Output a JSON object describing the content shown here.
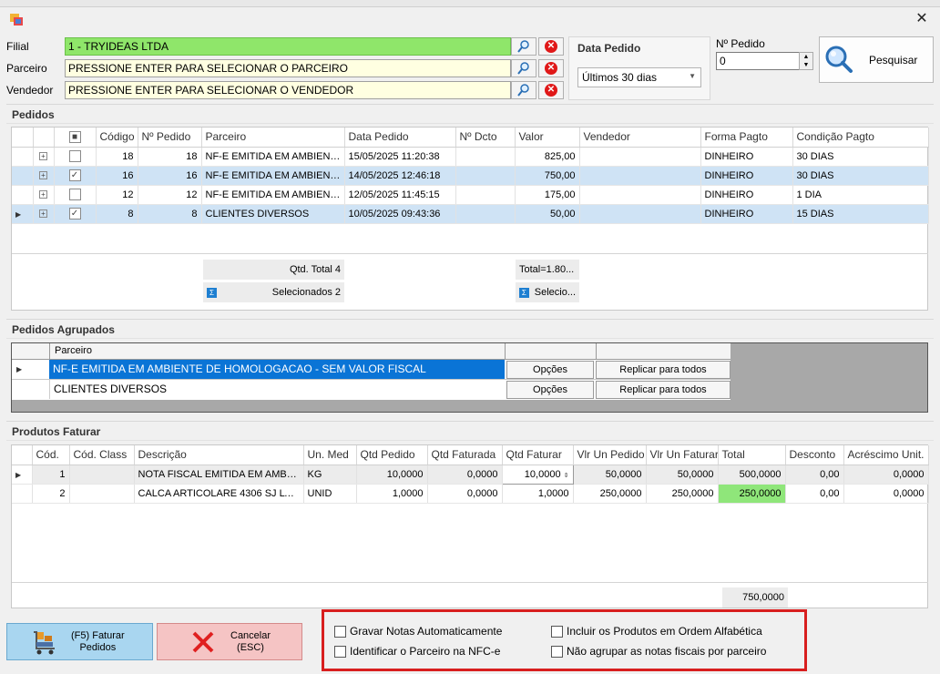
{
  "filters": {
    "filial_label": "Filial",
    "filial_value": "1 - TRYIDEAS LTDA",
    "parceiro_label": "Parceiro",
    "parceiro_value": "PRESSIONE ENTER PARA SELECIONAR O PARCEIRO",
    "vendedor_label": "Vendedor",
    "vendedor_value": "PRESSIONE ENTER PARA SELECIONAR O VENDEDOR",
    "data_pedido_label": "Data Pedido",
    "data_pedido_value": "Últimos 30 dias",
    "n_pedido_label": "Nº Pedido",
    "n_pedido_value": "0",
    "search_label": "Pesquisar"
  },
  "pedidos": {
    "title": "Pedidos",
    "columns": [
      "Código",
      "Nº Pedido",
      "Parceiro",
      "Data Pedido",
      "Nº Dcto",
      "Valor",
      "Vendedor",
      "Forma Pagto",
      "Condição Pagto"
    ],
    "rows": [
      {
        "checked": false,
        "codigo": "18",
        "n_pedido": "18",
        "parceiro": "NF-E EMITIDA EM AMBIENT...",
        "data": "15/05/2025 11:20:38",
        "dcto": "",
        "valor": "825,00",
        "vendedor": "",
        "forma": "DINHEIRO",
        "condicao": "30 DIAS",
        "selected": false
      },
      {
        "checked": true,
        "codigo": "16",
        "n_pedido": "16",
        "parceiro": "NF-E EMITIDA EM AMBIENT...",
        "data": "14/05/2025 12:46:18",
        "dcto": "",
        "valor": "750,00",
        "vendedor": "",
        "forma": "DINHEIRO",
        "condicao": "30 DIAS",
        "selected": true
      },
      {
        "checked": false,
        "codigo": "12",
        "n_pedido": "12",
        "parceiro": "NF-E EMITIDA EM AMBIENT...",
        "data": "12/05/2025 11:45:15",
        "dcto": "",
        "valor": "175,00",
        "vendedor": "",
        "forma": "DINHEIRO",
        "condicao": "1 DIA",
        "selected": false
      },
      {
        "checked": true,
        "codigo": "8",
        "n_pedido": "8",
        "parceiro": "CLIENTES DIVERSOS",
        "data": "10/05/2025 09:43:36",
        "dcto": "",
        "valor": "50,00",
        "vendedor": "",
        "forma": "DINHEIRO",
        "condicao": "15 DIAS",
        "selected": true
      }
    ],
    "qtd_total": "Qtd. Total 4",
    "selecionados": "Selecionados 2",
    "total_valor": "Total=1.80...",
    "selecio_valor": "Selecio..."
  },
  "agrupados": {
    "title": "Pedidos Agrupados",
    "column": "Parceiro",
    "rows": [
      {
        "parceiro": "NF-E EMITIDA EM AMBIENTE DE HOMOLOGACAO - SEM VALOR FISCAL",
        "opcoes": "Opções",
        "replicar": "Replicar para todos"
      },
      {
        "parceiro": "CLIENTES DIVERSOS",
        "opcoes": "Opções",
        "replicar": "Replicar para todos"
      }
    ]
  },
  "produtos": {
    "title": "Produtos Faturar",
    "columns": [
      "Cód.",
      "Cód. Class",
      "Descrição",
      "Un. Med",
      "Qtd Pedido",
      "Qtd Faturada",
      "Qtd Faturar",
      "Vlr Un Pedido",
      "Vlr Un Faturar",
      "Total",
      "Desconto",
      "Acréscimo Unit."
    ],
    "rows": [
      {
        "cod": "1",
        "class": "",
        "desc": "NOTA FISCAL EMITIDA EM AMBIE...",
        "un": "KG",
        "qtd_pedido": "10,0000",
        "qtd_faturada": "0,0000",
        "qtd_faturar": "10,0000",
        "vlr_pedido": "50,0000",
        "vlr_faturar": "50,0000",
        "total": "500,0000",
        "desconto": "0,00",
        "acrescimo": "0,0000"
      },
      {
        "cod": "2",
        "class": "",
        "desc": "CALCA ARTICOLARE 4306 SJ LY C ...",
        "un": "UNID",
        "qtd_pedido": "1,0000",
        "qtd_faturada": "0,0000",
        "qtd_faturar": "1,0000",
        "vlr_pedido": "250,0000",
        "vlr_faturar": "250,0000",
        "total": "250,0000",
        "desconto": "0,00",
        "acrescimo": "0,0000"
      }
    ],
    "sum_total": "750,0000"
  },
  "actions": {
    "faturar_label": "(F5) Faturar\nPedidos",
    "cancelar_label": "Cancelar\n(ESC)"
  },
  "options": {
    "gravar": "Gravar Notas Automaticamente",
    "identificar": "Identificar o Parceiro na NFC-e",
    "incluir": "Incluir os Produtos em Ordem Alfabética",
    "nao_agrupar": "Não agrupar as notas fiscais por parceiro"
  },
  "colors": {
    "filial_bg": "#8fe66a",
    "highlight_total": "#8fe67a",
    "faturar_bg": "#a9d6f0",
    "cancelar_bg": "#f5c4c4",
    "annotation_border": "#d81e1e",
    "selection_blue": "#0a74d6"
  }
}
